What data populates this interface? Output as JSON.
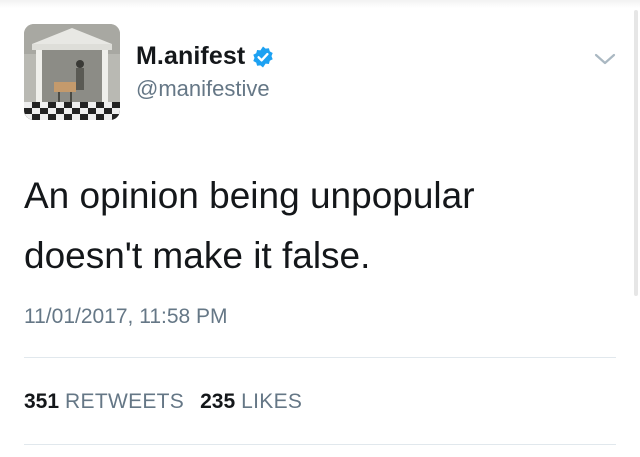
{
  "tweet": {
    "display_name": "M.anifest",
    "handle": "@manifestive",
    "verified": true,
    "text_line1": "An opinion being unpopular",
    "text_line2": "doesn't make it false.",
    "timestamp": "11/01/2017, 11:58 PM",
    "retweets": {
      "count": "351",
      "label": "RETWEETS"
    },
    "likes": {
      "count": "235",
      "label": "LIKES"
    }
  },
  "colors": {
    "verified_badge": "#1da1f2",
    "secondary_text": "#657786",
    "divider": "#e1e8ed"
  },
  "icons": {
    "verified": "verified-badge-icon",
    "menu": "chevron-down-icon"
  }
}
